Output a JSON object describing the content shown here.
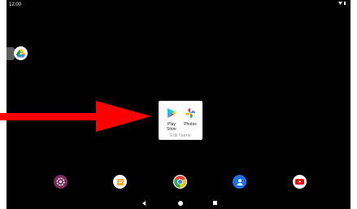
{
  "status_bar": {
    "time": "12:00",
    "icons": [
      "wifi-icon",
      "battery-icon"
    ]
  },
  "side_shortcut": {
    "icon": "google-drive-icon"
  },
  "folder": {
    "apps": [
      {
        "label": "Play\nStore",
        "icon": "play-store-icon"
      },
      {
        "label": "Photos",
        "icon": "photos-icon"
      }
    ],
    "name_placeholder": "Edit Name"
  },
  "dock": [
    {
      "name": "settings",
      "icon": "settings-icon",
      "color": "#7b2d5f"
    },
    {
      "name": "sticky-notes",
      "icon": "notes-icon",
      "color": "#f9a825"
    },
    {
      "name": "chrome",
      "icon": "chrome-icon",
      "color": "#4285f4"
    },
    {
      "name": "contacts",
      "icon": "contacts-icon",
      "color": "#1a73e8"
    },
    {
      "name": "youtube",
      "icon": "youtube-icon",
      "color": "#ff0000"
    }
  ],
  "nav_bar": {
    "icons": [
      "back-icon",
      "home-icon",
      "recents-icon"
    ]
  },
  "annotation": {
    "icon": "red-arrow-icon",
    "color": "#ff0000"
  }
}
